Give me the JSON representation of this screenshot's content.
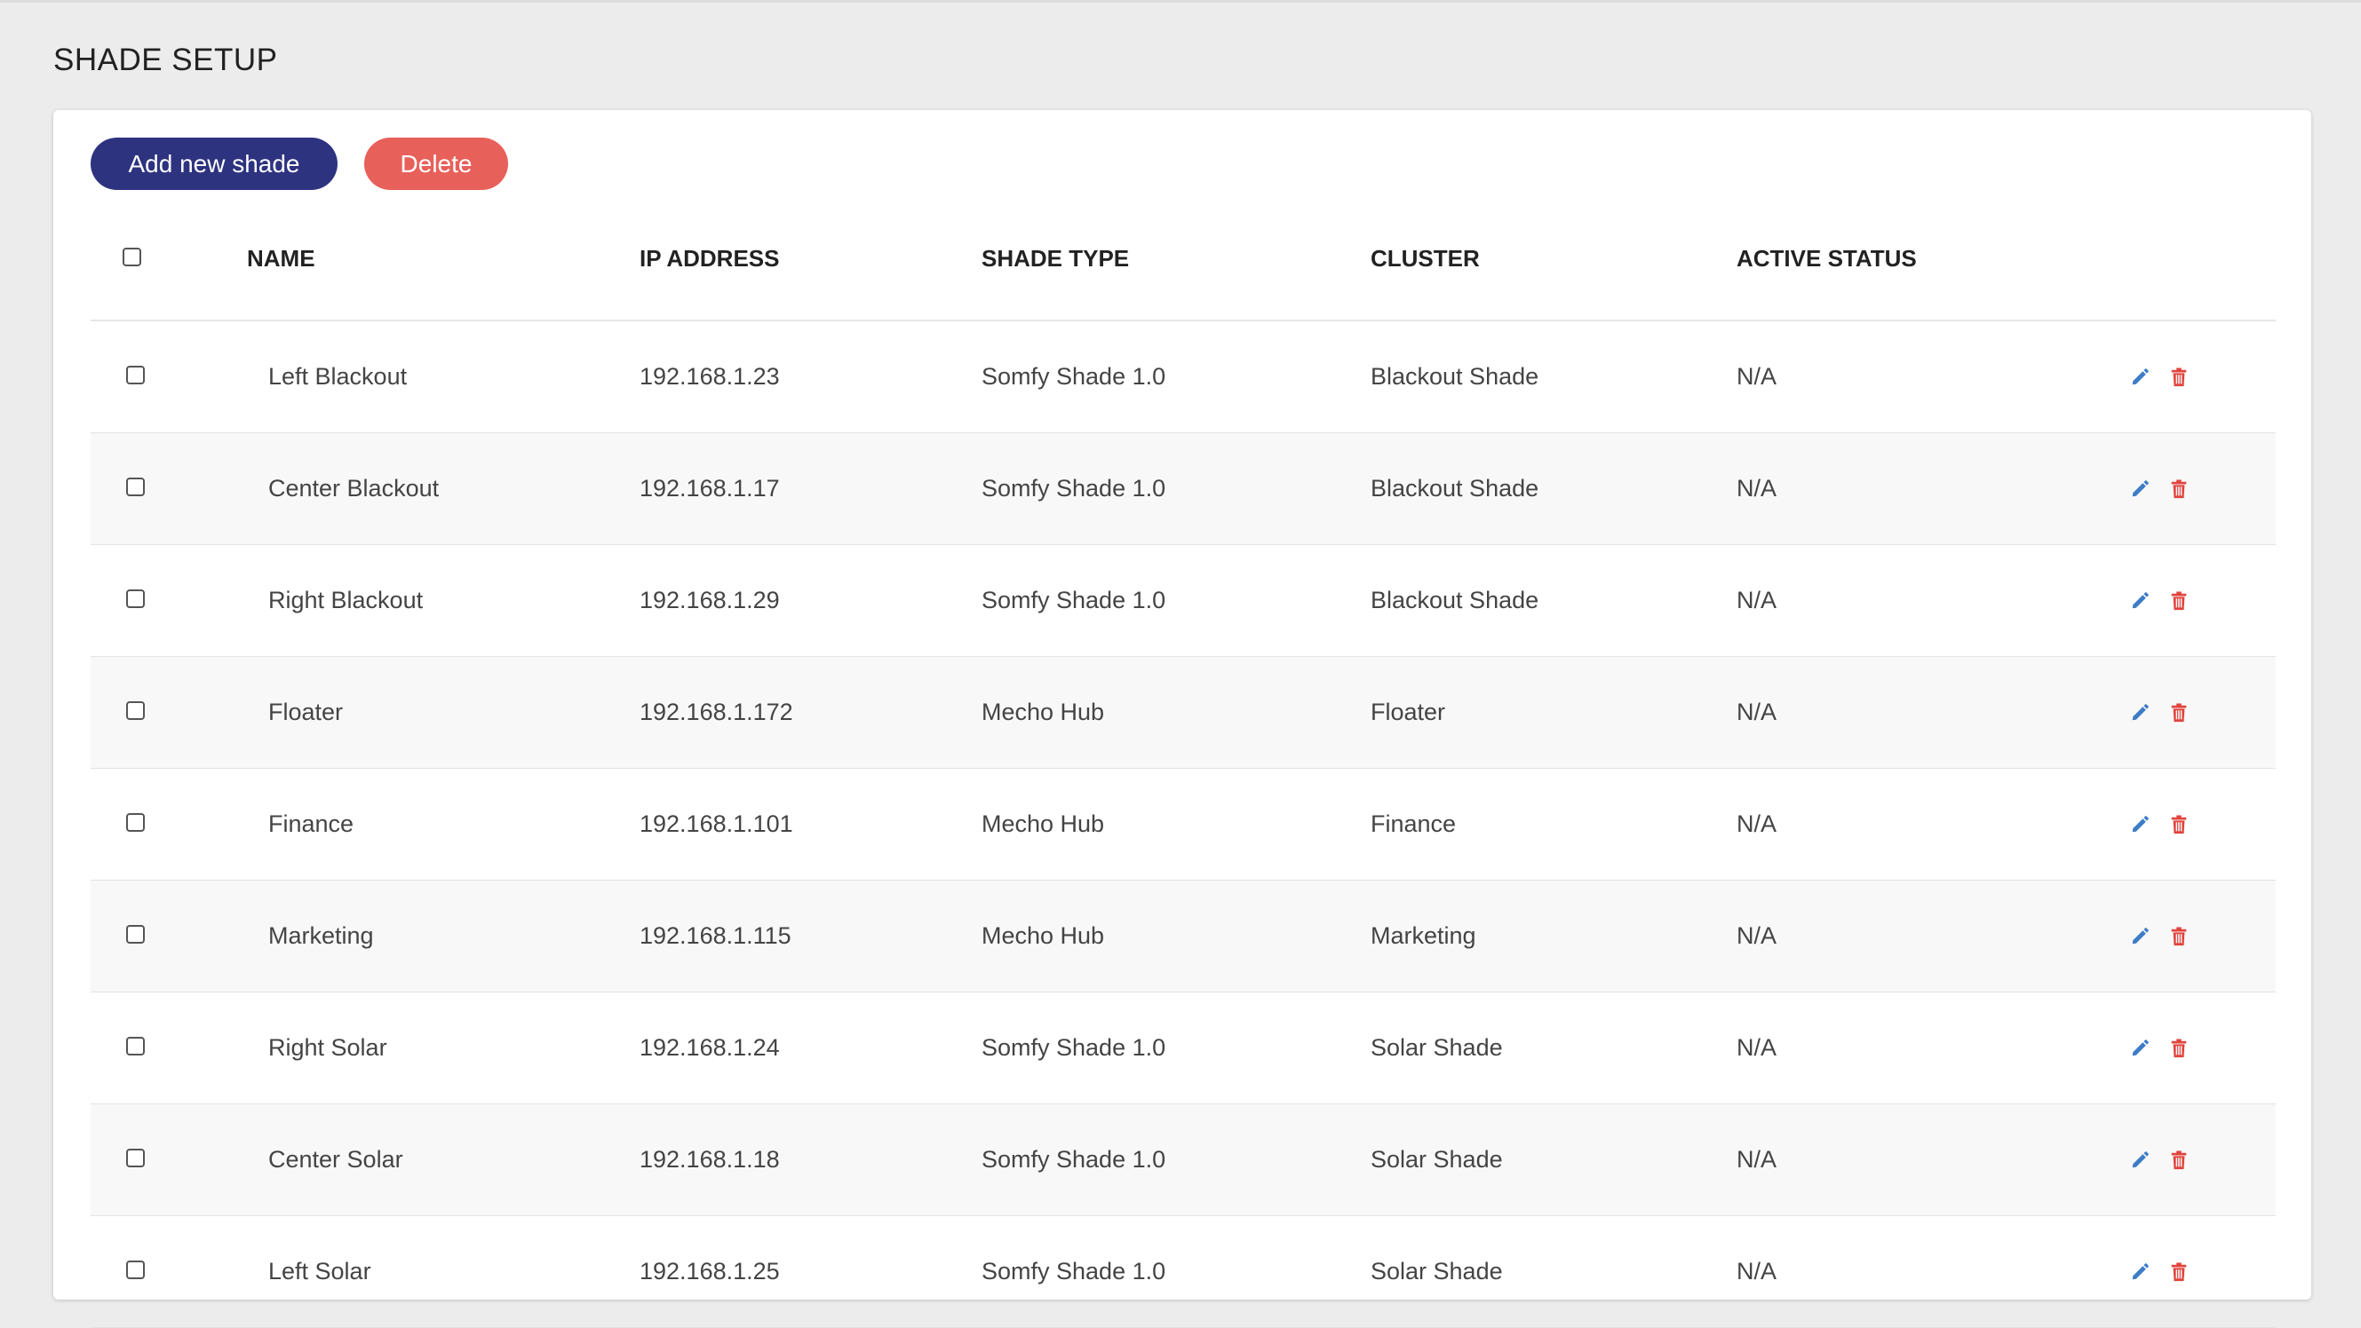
{
  "page": {
    "title": "SHADE SETUP"
  },
  "toolbar": {
    "add_label": "Add new shade",
    "delete_label": "Delete"
  },
  "colors": {
    "primary": "#2e3380",
    "danger": "#e8605a",
    "edit_icon": "#3d7cc7",
    "delete_icon": "#e0443e"
  },
  "icons": {
    "edit": "pencil-icon",
    "delete": "trash-icon"
  },
  "table": {
    "columns": [
      "NAME",
      "IP ADDRESS",
      "SHADE TYPE",
      "CLUSTER",
      "ACTIVE STATUS"
    ],
    "rows": [
      {
        "name": "Left Blackout",
        "ip": "192.168.1.23",
        "type": "Somfy Shade 1.0",
        "cluster": "Blackout Shade",
        "status": "N/A"
      },
      {
        "name": "Center Blackout",
        "ip": "192.168.1.17",
        "type": "Somfy Shade 1.0",
        "cluster": "Blackout Shade",
        "status": "N/A"
      },
      {
        "name": "Right Blackout",
        "ip": "192.168.1.29",
        "type": "Somfy Shade 1.0",
        "cluster": "Blackout Shade",
        "status": "N/A"
      },
      {
        "name": "Floater",
        "ip": "192.168.1.172",
        "type": "Mecho Hub",
        "cluster": "Floater",
        "status": "N/A"
      },
      {
        "name": "Finance",
        "ip": "192.168.1.101",
        "type": "Mecho Hub",
        "cluster": "Finance",
        "status": "N/A"
      },
      {
        "name": "Marketing",
        "ip": "192.168.1.115",
        "type": "Mecho Hub",
        "cluster": "Marketing",
        "status": "N/A"
      },
      {
        "name": "Right Solar",
        "ip": "192.168.1.24",
        "type": "Somfy Shade 1.0",
        "cluster": "Solar Shade",
        "status": "N/A"
      },
      {
        "name": "Center Solar",
        "ip": "192.168.1.18",
        "type": "Somfy Shade 1.0",
        "cluster": "Solar Shade",
        "status": "N/A"
      },
      {
        "name": "Left Solar",
        "ip": "192.168.1.25",
        "type": "Somfy Shade 1.0",
        "cluster": "Solar Shade",
        "status": "N/A"
      }
    ]
  }
}
